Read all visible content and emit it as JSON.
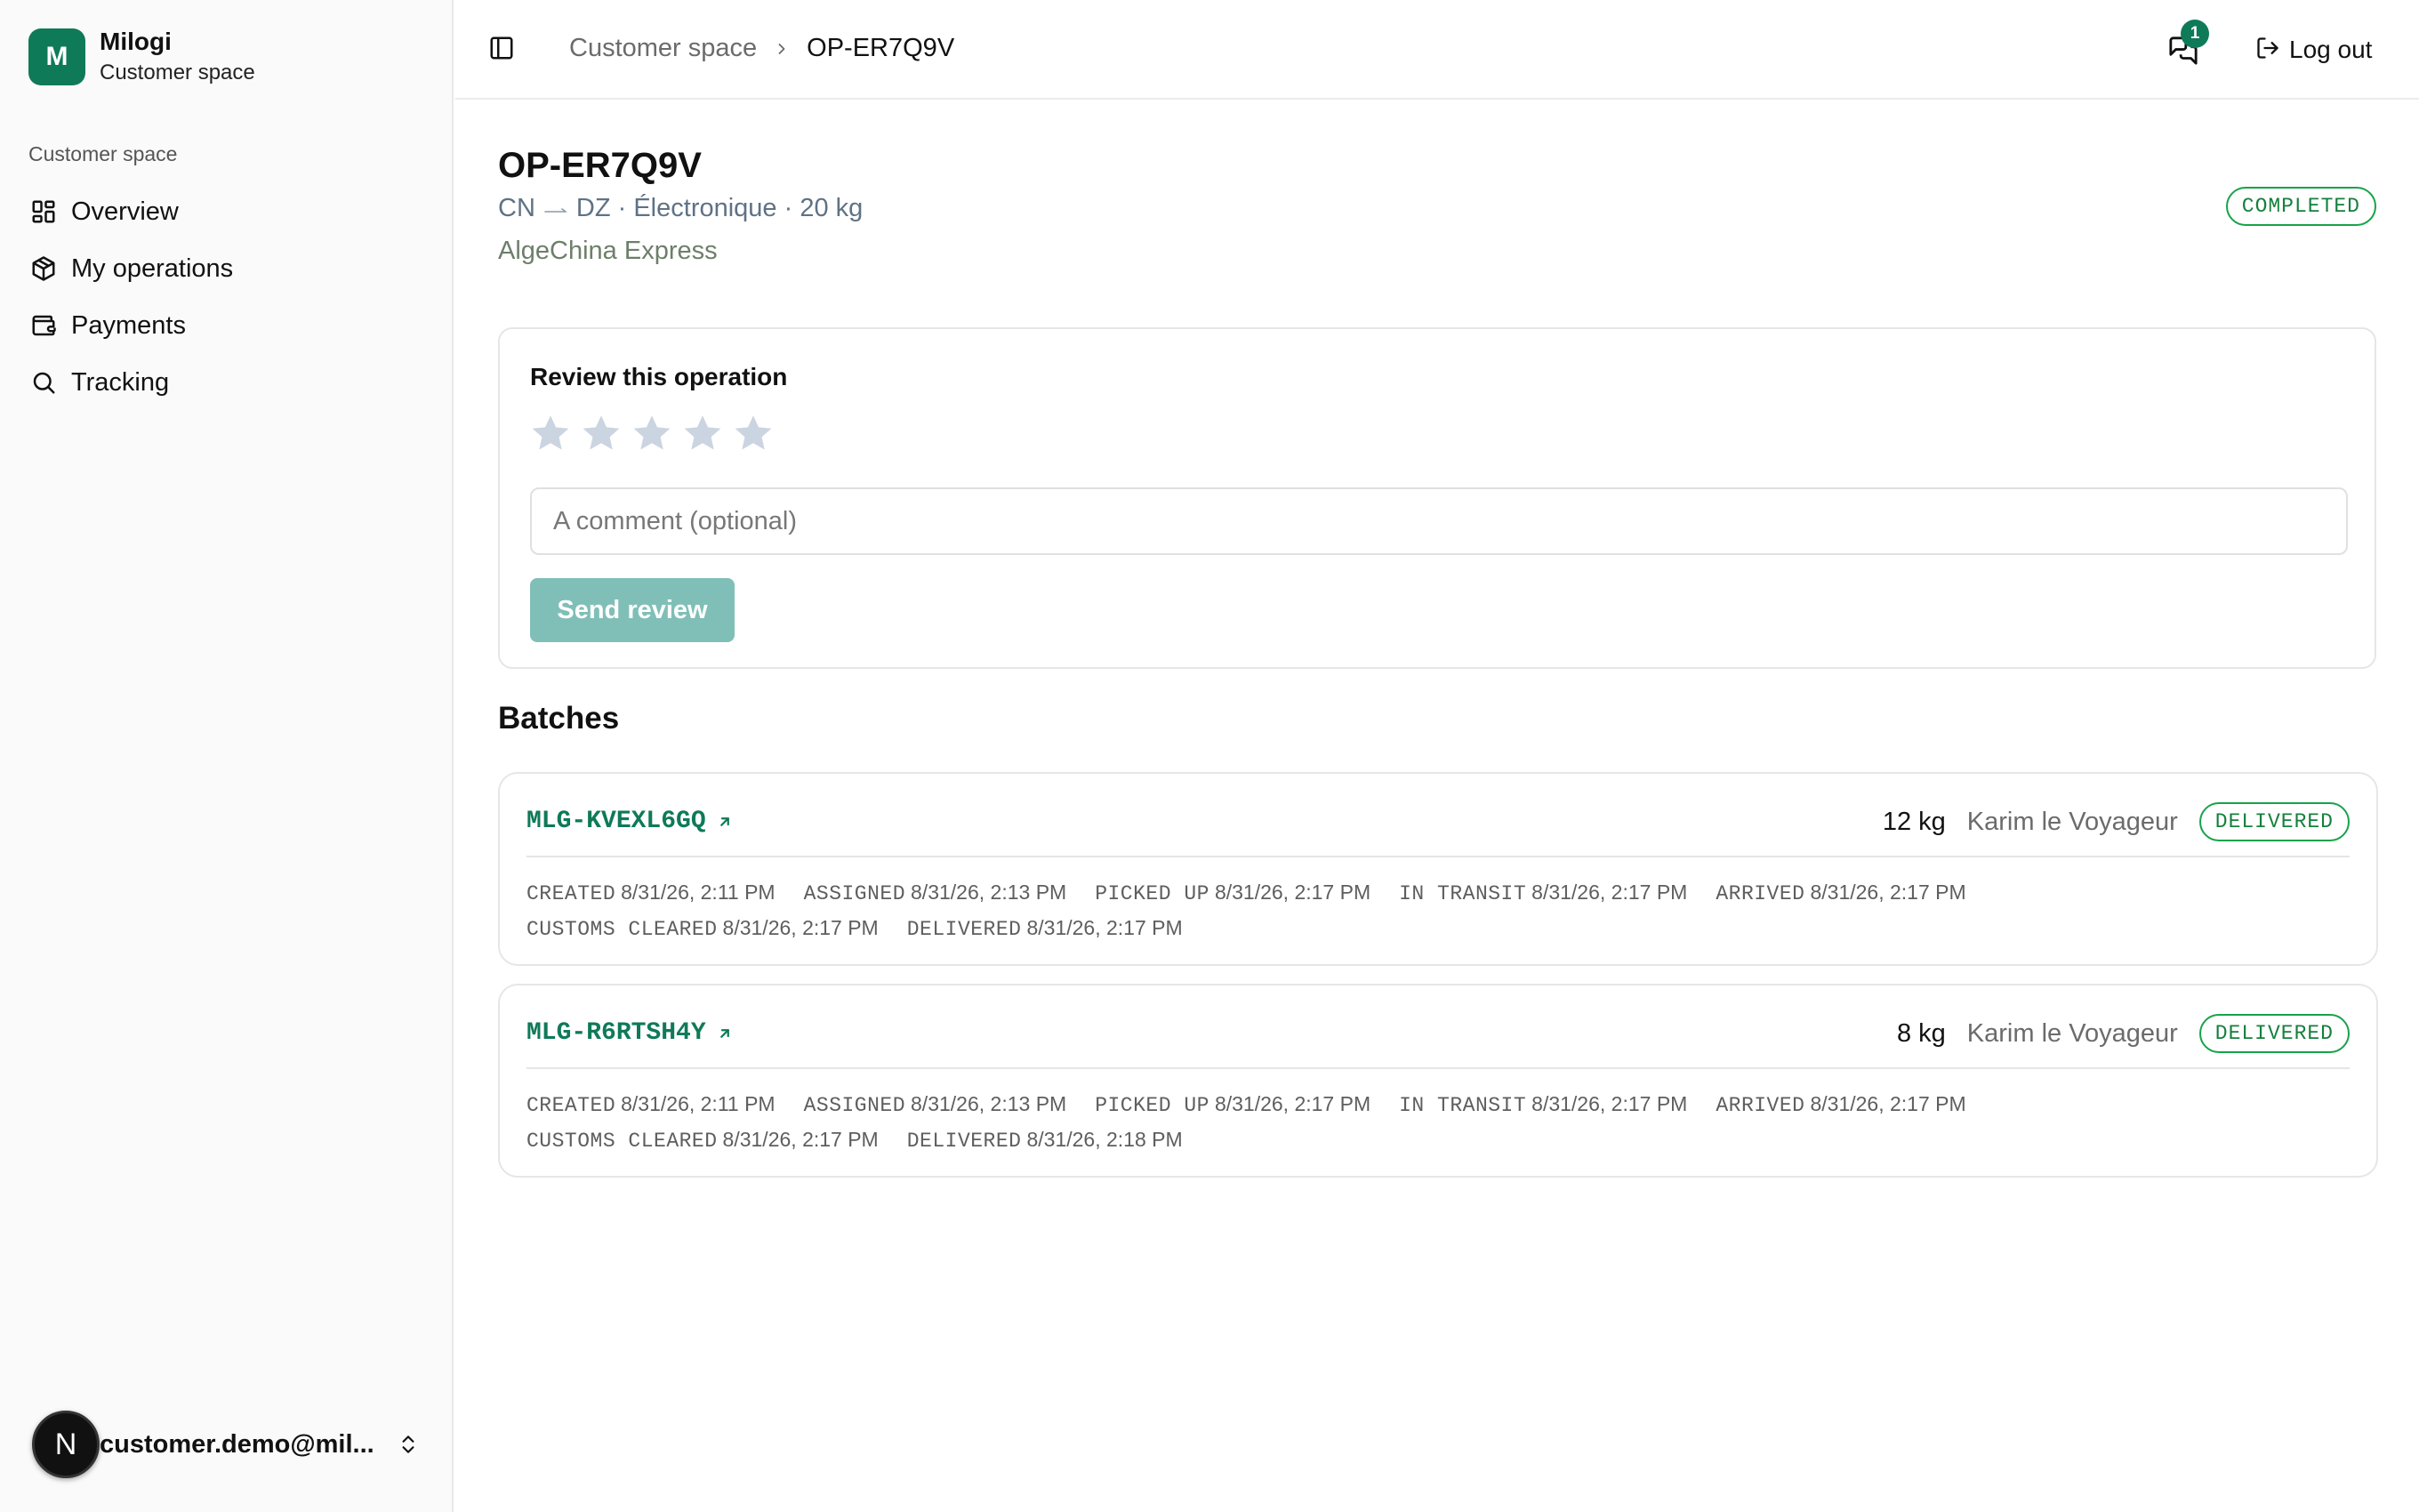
{
  "brand": {
    "logo_letter": "M",
    "name": "Milogi",
    "subtitle": "Customer space"
  },
  "sidebar": {
    "section_label": "Customer space",
    "items": [
      {
        "label": "Overview",
        "icon": "grid-icon"
      },
      {
        "label": "My operations",
        "icon": "package-icon"
      },
      {
        "label": "Payments",
        "icon": "wallet-icon"
      },
      {
        "label": "Tracking",
        "icon": "search-icon"
      }
    ],
    "user": {
      "avatar_letter": "N",
      "email": "customer.demo@mil..."
    }
  },
  "header": {
    "breadcrumb": {
      "parent": "Customer space",
      "current": "OP-ER7Q9V"
    },
    "messages_badge": "1",
    "logout_label": "Log out"
  },
  "operation": {
    "id": "OP-ER7Q9V",
    "origin": "CN",
    "destination": "DZ",
    "category": "Électronique",
    "weight": "20 kg",
    "carrier": "AlgeChina Express",
    "status": "COMPLETED"
  },
  "review": {
    "title": "Review this operation",
    "rating": 0,
    "max_rating": 5,
    "comment_placeholder": "A comment (optional)",
    "comment_value": "",
    "send_label": "Send review"
  },
  "batches_title": "Batches",
  "batches": [
    {
      "id": "MLG-KVEXL6GQ",
      "weight": "12 kg",
      "carrier": "Karim le Voyageur",
      "status": "DELIVERED",
      "events": [
        {
          "label": "CREATED",
          "date": "8/31/26, 2:11 PM"
        },
        {
          "label": "ASSIGNED",
          "date": "8/31/26, 2:13 PM"
        },
        {
          "label": "PICKED UP",
          "date": "8/31/26, 2:17 PM"
        },
        {
          "label": "IN TRANSIT",
          "date": "8/31/26, 2:17 PM"
        },
        {
          "label": "ARRIVED",
          "date": "8/31/26, 2:17 PM"
        },
        {
          "label": "CUSTOMS CLEARED",
          "date": "8/31/26, 2:17 PM"
        },
        {
          "label": "DELIVERED",
          "date": "8/31/26, 2:17 PM"
        }
      ]
    },
    {
      "id": "MLG-R6RTSH4Y",
      "weight": "8 kg",
      "carrier": "Karim le Voyageur",
      "status": "DELIVERED",
      "events": [
        {
          "label": "CREATED",
          "date": "8/31/26, 2:11 PM"
        },
        {
          "label": "ASSIGNED",
          "date": "8/31/26, 2:13 PM"
        },
        {
          "label": "PICKED UP",
          "date": "8/31/26, 2:17 PM"
        },
        {
          "label": "IN TRANSIT",
          "date": "8/31/26, 2:17 PM"
        },
        {
          "label": "ARRIVED",
          "date": "8/31/26, 2:17 PM"
        },
        {
          "label": "CUSTOMS CLEARED",
          "date": "8/31/26, 2:17 PM"
        },
        {
          "label": "DELIVERED",
          "date": "8/31/26, 2:18 PM"
        }
      ]
    }
  ],
  "colors": {
    "brand": "#0f7a58",
    "status_green": "#16a34a",
    "button_disabled": "#80bfb8",
    "star_empty": "#cbd5e1"
  }
}
